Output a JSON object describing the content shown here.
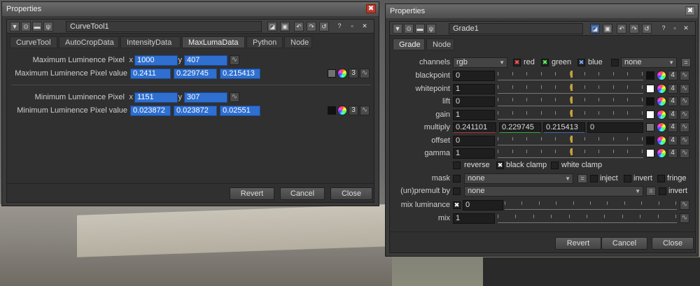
{
  "left": {
    "window_title": "Properties",
    "close_glyph": "✖",
    "node_name": "CurveTool1",
    "tabs": [
      "CurveTool",
      "AutoCropData",
      "IntensityData",
      "MaxLumaData",
      "Python",
      "Node"
    ],
    "max_pixel_label": "Maximum Luminence Pixel",
    "max_value_label": "Maximum Luminence Pixel value",
    "min_pixel_label": "Minimum Luminence Pixel",
    "min_value_label": "Minimum Luminence Pixel value",
    "x_lbl": "x",
    "y_lbl": "y",
    "max_x": "1000",
    "max_y": "407",
    "max_v": [
      "0.2411",
      "0.229745",
      "0.215413"
    ],
    "min_x": "1151",
    "min_y": "307",
    "min_v": [
      "0.023872",
      "0.023872",
      "0.02551"
    ],
    "count": "3",
    "revert": "Revert",
    "cancel": "Cancel",
    "close": "Close"
  },
  "right": {
    "window_title": "Properties",
    "node_name": "Grade1",
    "tabs": [
      "Grade",
      "Node"
    ],
    "channels_label": "channels",
    "channels_value": "rgb",
    "red": "red",
    "green": "green",
    "blue": "blue",
    "none": "none",
    "rows": [
      {
        "label": "blackpoint",
        "value": "0"
      },
      {
        "label": "whitepoint",
        "value": "1"
      },
      {
        "label": "lift",
        "value": "0"
      },
      {
        "label": "gain",
        "value": "1"
      },
      {
        "label": "multiply",
        "value": "0.241101"
      },
      {
        "label": "offset",
        "value": "0"
      },
      {
        "label": "gamma",
        "value": "1"
      }
    ],
    "multiply_extra": [
      "0.229745",
      "0.215413",
      "0"
    ],
    "count": "4",
    "reverse": "reverse",
    "black_clamp": "black clamp",
    "white_clamp": "white clamp",
    "mask_label": "mask",
    "mask_value": "none",
    "inject": "inject",
    "invert": "invert",
    "fringe": "fringe",
    "premult_label": "(un)premult by",
    "premult_value": "none",
    "invert2": "invert",
    "mixlum_label": "mix luminance",
    "mixlum_value": "0",
    "mix_label": "mix",
    "mix_value": "1",
    "revert": "Revert",
    "cancel": "Cancel",
    "close": "Close"
  },
  "colors": {
    "accent_blue": "#2e6fd0",
    "marker": "#c8a030"
  }
}
